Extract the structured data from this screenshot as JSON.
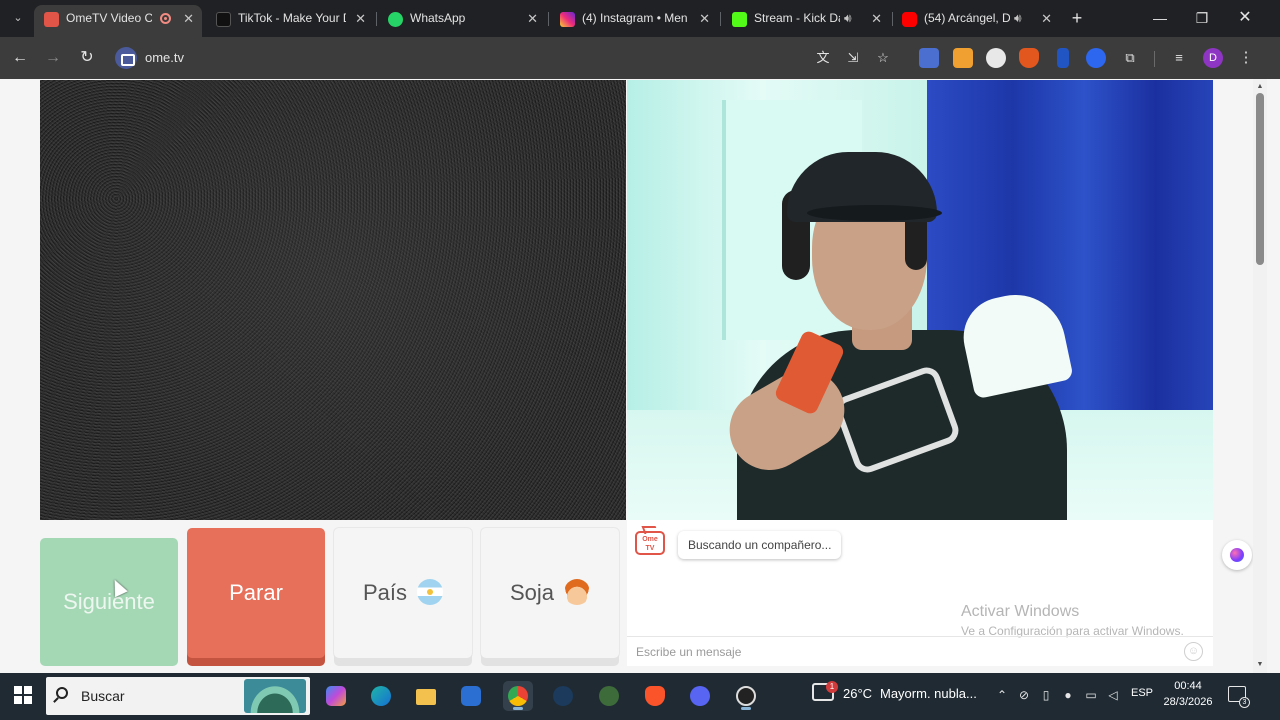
{
  "browser": {
    "tabs": [
      {
        "title": "OmeTV Video Ch",
        "active": true,
        "icon": "ometv-favicon",
        "recording": true
      },
      {
        "title": "TikTok - Make Your D",
        "icon": "tiktok-favicon"
      },
      {
        "title": "WhatsApp",
        "icon": "whatsapp-favicon"
      },
      {
        "title": "(4) Instagram • Mens",
        "icon": "instagram-favicon"
      },
      {
        "title": "Stream - Kick Da",
        "icon": "kick-favicon",
        "audio": true
      },
      {
        "title": "(54) Arcángel, D",
        "icon": "youtube-favicon",
        "audio": true
      }
    ],
    "url": "ome.tv",
    "profile_initial": "D",
    "tab_close_glyph": "✕",
    "newtab_glyph": "+"
  },
  "page": {
    "buttons": {
      "next": "Siguiente",
      "stop": "Parar",
      "country": "País",
      "gender": "Soja"
    },
    "chat": {
      "status_message": "Buscando un compañero...",
      "input_placeholder": "Escribe un mensaje",
      "logo_text": "Ome TV"
    },
    "watermark": {
      "title": "Activar Windows",
      "subtitle": "Ve a Configuración para activar Windows."
    }
  },
  "taskbar": {
    "search_placeholder": "Buscar",
    "weather": {
      "temperature": "26°C",
      "description": "Mayorm. nubla...",
      "badge": "1"
    },
    "language": "ESP",
    "time": "00:44",
    "date": "28/3/2026",
    "notification_count": "3"
  },
  "colors": {
    "next_button": "#a4d8b5",
    "stop_button": "#e7705a",
    "neutral_button": "#f5f5f5",
    "brand_red": "#e05548"
  }
}
